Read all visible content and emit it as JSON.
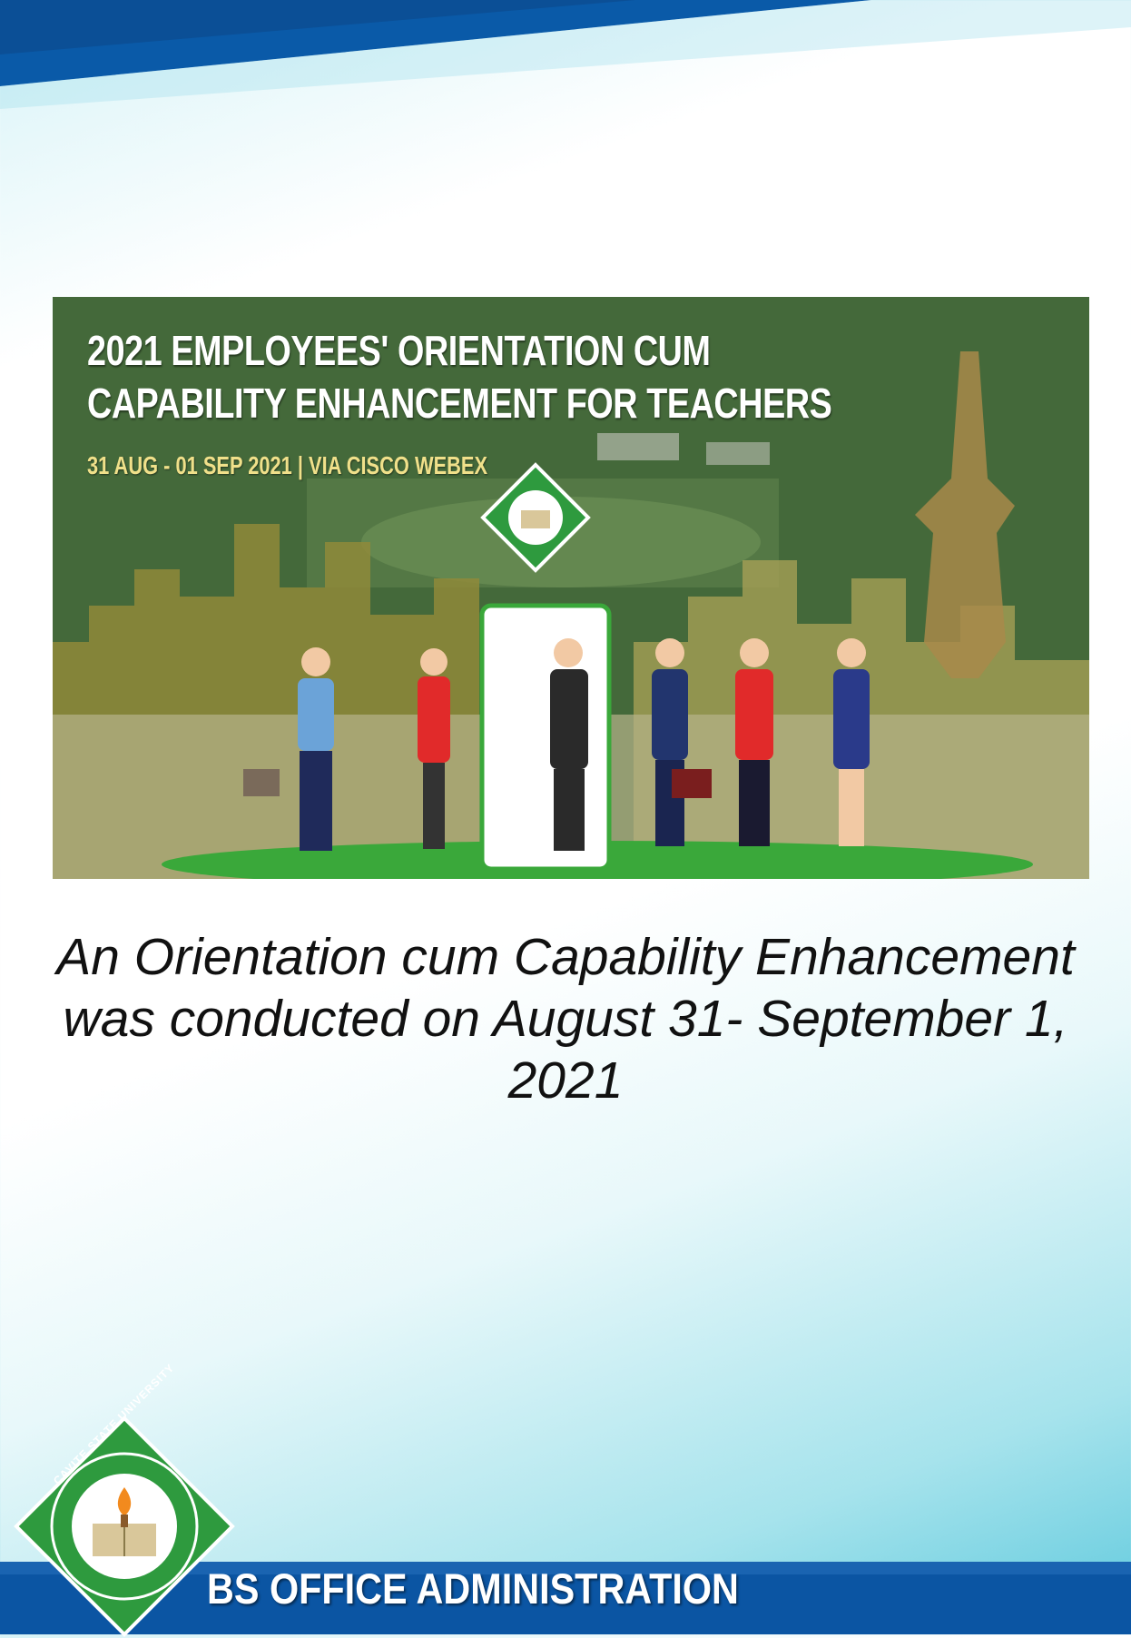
{
  "banner": {
    "title_line1": "2021 EMPLOYEES' ORIENTATION CUM",
    "title_line2": "CAPABILITY ENHANCEMENT FOR TEACHERS",
    "subtitle": "31 AUG - 01 SEP 2021 | VIA CISCO WEBEX"
  },
  "caption": "An Orientation cum Capability Enhancement was conducted on August 31- September 1, 2021",
  "footer": {
    "program": "BS OFFICE ADMINISTRATION",
    "seal_text": "CAVITE STATE UNIVERSITY"
  },
  "colors": {
    "top_band": "#0a5aa8",
    "footer_band": "#0b55a3",
    "accent_teal": "#5ec9dd",
    "seal_green": "#2e9a3e"
  },
  "icons": [
    "university-seal-icon"
  ]
}
